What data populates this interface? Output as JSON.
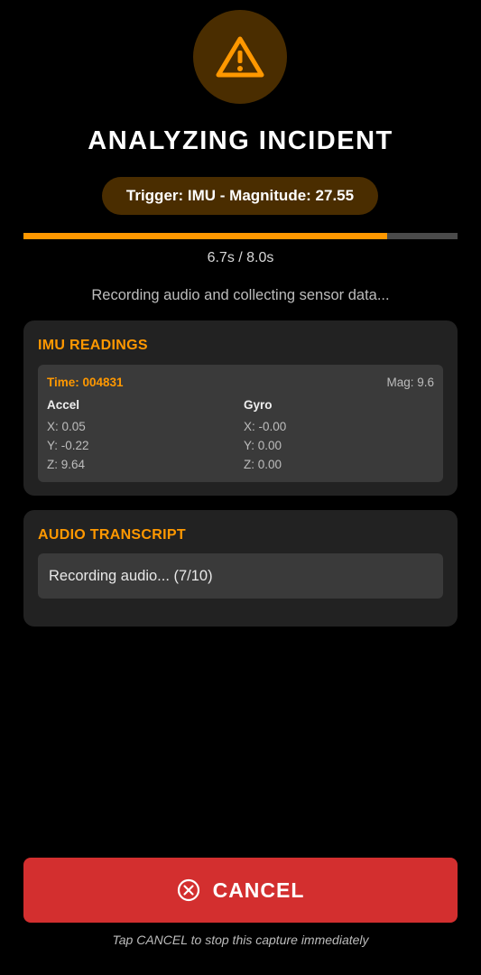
{
  "header": {
    "icon": "warning-triangle-icon",
    "title": "ANALYZING INCIDENT",
    "trigger": "Trigger: IMU - Magnitude: 27.55"
  },
  "progress": {
    "fraction": 0.8375,
    "text": "6.7s / 8.0s",
    "status": "Recording audio and collecting sensor data..."
  },
  "imu": {
    "title": "IMU READINGS",
    "time": "Time: 004831",
    "mag": "Mag: 9.6",
    "accel": {
      "label": "Accel",
      "x": "X: 0.05",
      "y": "Y: -0.22",
      "z": "Z: 9.64"
    },
    "gyro": {
      "label": "Gyro",
      "x": "X: -0.00",
      "y": "Y: 0.00",
      "z": "Z: 0.00"
    }
  },
  "audio": {
    "title": "AUDIO TRANSCRIPT",
    "transcript": "Recording audio... (7/10)"
  },
  "cancel": {
    "icon": "close-circle-icon",
    "label": "CANCEL",
    "hint": "Tap CANCEL to stop this capture immediately"
  },
  "colors": {
    "accent": "#ff9800",
    "accent_dark": "#4a2d00",
    "danger": "#d32f2f",
    "card": "#222222",
    "inner_box": "#3a3a3a",
    "background": "#000000"
  }
}
